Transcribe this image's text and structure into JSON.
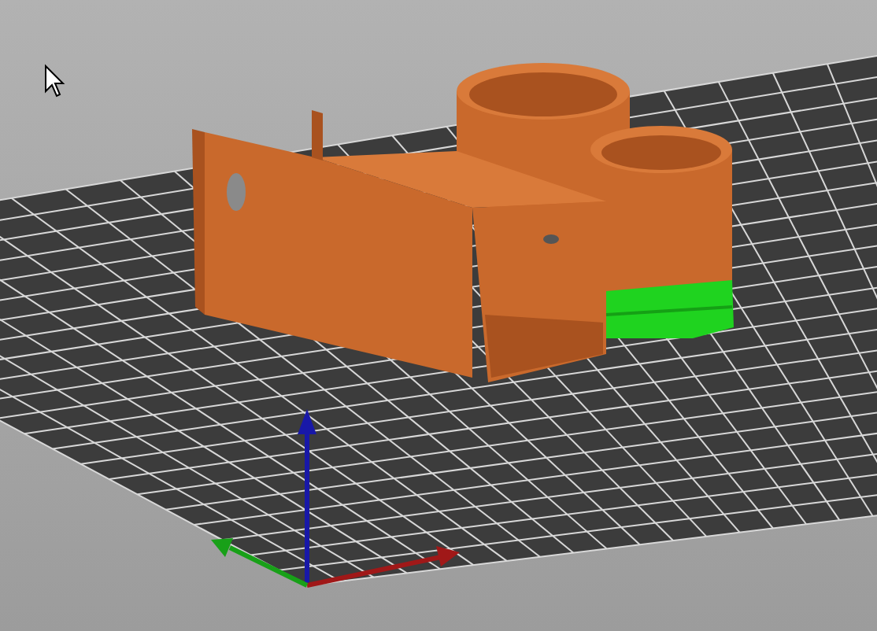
{
  "viewport": {
    "kind": "print-preview",
    "cursor_visible": true
  }
}
